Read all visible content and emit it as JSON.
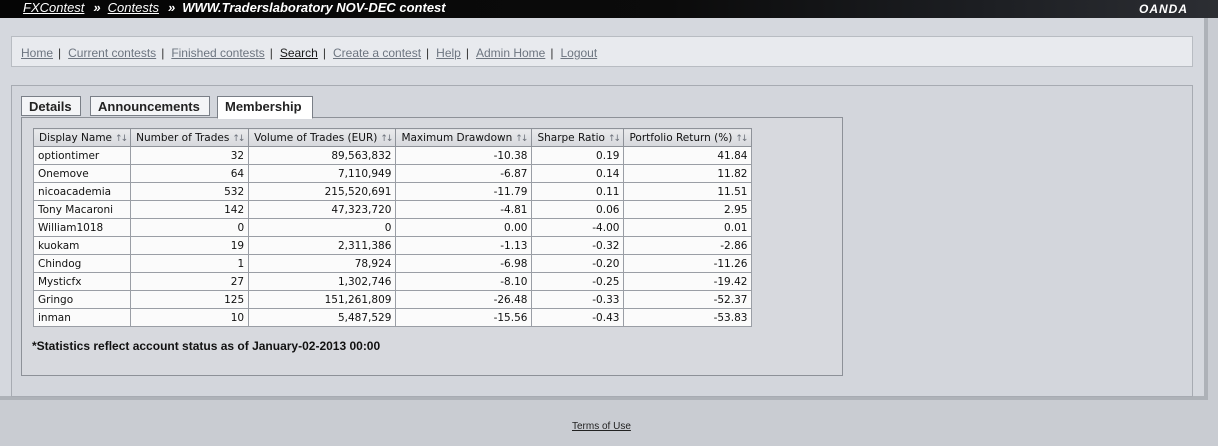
{
  "breadcrumb": {
    "root": "FXContest",
    "contests": "Contests",
    "current": "WWW.Traderslaboratory NOV-DEC contest",
    "separator": "»"
  },
  "brand": "OANDA",
  "nav": {
    "items": [
      {
        "label": "Home"
      },
      {
        "label": "Current contests"
      },
      {
        "label": "Finished contests"
      },
      {
        "label": "Search"
      },
      {
        "label": "Create a contest"
      },
      {
        "label": "Help"
      },
      {
        "label": "Admin Home"
      },
      {
        "label": "Logout"
      }
    ],
    "separator": "|"
  },
  "tabs": {
    "details": "Details",
    "announcements": "Announcements",
    "membership": "Membership",
    "active": "Membership"
  },
  "table": {
    "sort_icon": "sort-arrows-icon",
    "headers": [
      "Display Name",
      "Number of Trades",
      "Volume of Trades (EUR)",
      "Maximum Drawdown",
      "Sharpe Ratio",
      "Portfolio Return (%)"
    ],
    "rows": [
      [
        "optiontimer",
        "32",
        "89,563,832",
        "-10.38",
        "0.19",
        "41.84"
      ],
      [
        "Onemove",
        "64",
        "7,110,949",
        "-6.87",
        "0.14",
        "11.82"
      ],
      [
        "nicoacademia",
        "532",
        "215,520,691",
        "-11.79",
        "0.11",
        "11.51"
      ],
      [
        "Tony Macaroni",
        "142",
        "47,323,720",
        "-4.81",
        "0.06",
        "2.95"
      ],
      [
        "William1018",
        "0",
        "0",
        "0.00",
        "-4.00",
        "0.01"
      ],
      [
        "kuokam",
        "19",
        "2,311,386",
        "-1.13",
        "-0.32",
        "-2.86"
      ],
      [
        "Chindog",
        "1",
        "78,924",
        "-6.98",
        "-0.20",
        "-11.26"
      ],
      [
        "Mysticfx",
        "27",
        "1,302,746",
        "-8.10",
        "-0.25",
        "-19.42"
      ],
      [
        "Gringo",
        "125",
        "151,261,809",
        "-26.48",
        "-0.33",
        "-52.37"
      ],
      [
        "inman",
        "10",
        "5,487,529",
        "-15.56",
        "-0.43",
        "-53.83"
      ]
    ]
  },
  "footnote": "*Statistics reflect account status as of January-02-2013 00:00",
  "footer": {
    "terms": "Terms of Use"
  }
}
